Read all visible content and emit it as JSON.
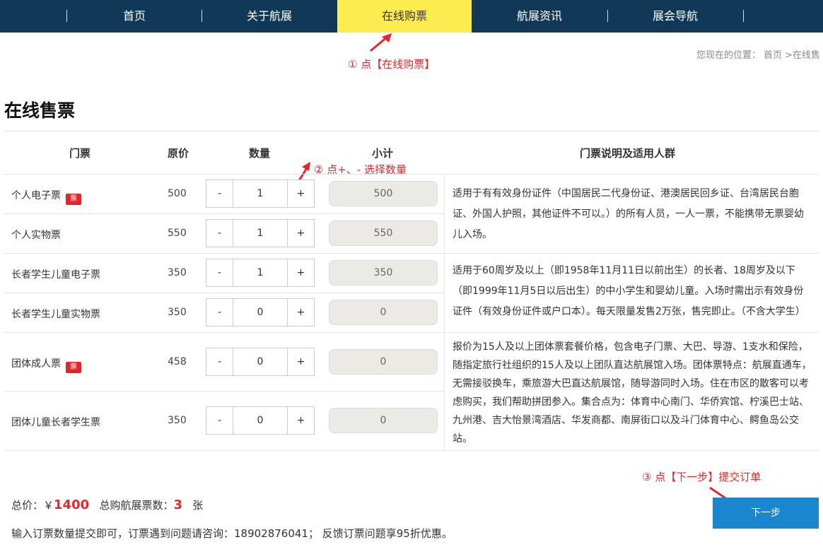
{
  "nav": {
    "items": [
      {
        "label": "首页"
      },
      {
        "label": "关于航展"
      },
      {
        "label": "在线购票"
      },
      {
        "label": "航展资讯"
      },
      {
        "label": "展会导航"
      }
    ],
    "active_color": "#fdec4f",
    "bg_color": "#123858"
  },
  "annotations": {
    "step1": "① 点【在线购票】",
    "step2": "② 点+、- 选择数量",
    "step3": "③ 点【下一步】提交订单"
  },
  "breadcrumb": {
    "prefix": "您现在的位置：",
    "home": "首页",
    "current": ">在线售"
  },
  "page_title": "在线售票",
  "table": {
    "headers": {
      "ticket": "门票",
      "price": "原价",
      "qty": "数量",
      "subtotal": "小计",
      "desc": "门票说明及适用人群"
    },
    "rows": [
      {
        "name": "个人电子票",
        "price": "500",
        "qty": "1",
        "subtotal": "500",
        "badge": true
      },
      {
        "name": "个人实物票",
        "price": "550",
        "qty": "1",
        "subtotal": "550",
        "badge": false
      },
      {
        "name": "长者学生儿童电子票",
        "price": "350",
        "qty": "1",
        "subtotal": "350",
        "badge": false
      },
      {
        "name": "长者学生儿童实物票",
        "price": "350",
        "qty": "0",
        "subtotal": "0",
        "badge": false
      },
      {
        "name": "团体成人票",
        "price": "458",
        "qty": "0",
        "subtotal": "0",
        "badge": true
      },
      {
        "name": "团体儿童长者学生票",
        "price": "350",
        "qty": "0",
        "subtotal": "0",
        "badge": false
      }
    ],
    "minus": "-",
    "plus": "+",
    "descriptions": [
      "适用于有有效身份证件（中国居民二代身份证、港澳居民回乡证、台湾居民台胞证、外国人护照，其他证件不可以。）的所有人员，一人一票，不能携带无票婴幼儿入场。",
      "适用于60周岁及以上（即1958年11月11日以前出生）的长者、18周岁及以下（即1999年11月5日以后出生）的中小学生和婴幼儿童。入场时需出示有效身份证件（有效身份证件或户口本）。每天限量发售2万张，售完即止。（不含大学生）",
      "报价为15人及以上团体票套餐价格，包含电子门票、大巴、导游、1支水和保险，随指定旅行社组织的15人及以上团队直达航展馆入场。团体票特点：航展直通车，无需接驳换车，乘旅游大巴直达航展馆，随导游同时入场。住在市区的散客可以考虑购买，我们帮助拼团参入。集合点为：体育中心南门、华侨宾馆、柠溪巴士站、九州港、吉大怡景湾酒店、华发商都、南屏街口以及斗门体育中心、鳄鱼岛公交站。"
    ]
  },
  "summary": {
    "total_label": "总价：￥",
    "total_value": "1400",
    "count_label": "总购航展票数：",
    "count_value": "3",
    "count_unit": "张"
  },
  "next_button": "下一步",
  "notice": "输入订票数量提交即可，订票遇到问题请咨询：18902876041； 反馈订票问题享95折优惠。",
  "accent_color": "#e8262a",
  "button_color": "#1a86cf"
}
